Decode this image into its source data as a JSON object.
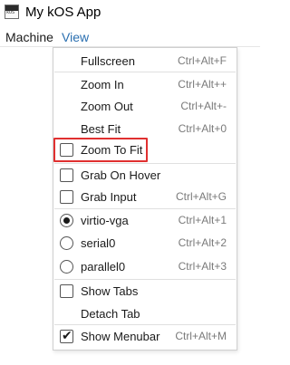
{
  "window": {
    "title": "My kOS App",
    "icon": "kos-app-icon",
    "icon_text": "kOS"
  },
  "menubar": {
    "items": [
      {
        "label": "Machine"
      },
      {
        "label": "View"
      }
    ]
  },
  "view_menu": {
    "items": [
      {
        "label": "Fullscreen",
        "shortcut": "Ctrl+Alt+F"
      },
      {
        "label": "Zoom In",
        "shortcut": "Ctrl+Alt++"
      },
      {
        "label": "Zoom Out",
        "shortcut": "Ctrl+Alt+-"
      },
      {
        "label": "Best Fit",
        "shortcut": "Ctrl+Alt+0"
      },
      {
        "label": "Zoom To Fit",
        "shortcut": "",
        "checked": false
      },
      {
        "label": "Grab On Hover",
        "shortcut": "",
        "checked": false
      },
      {
        "label": "Grab Input",
        "shortcut": "Ctrl+Alt+G",
        "checked": false
      },
      {
        "label": "virtio-vga",
        "shortcut": "Ctrl+Alt+1",
        "selected": true
      },
      {
        "label": "serial0",
        "shortcut": "Ctrl+Alt+2",
        "selected": false
      },
      {
        "label": "parallel0",
        "shortcut": "Ctrl+Alt+3",
        "selected": false
      },
      {
        "label": "Show Tabs",
        "shortcut": "",
        "checked": false
      },
      {
        "label": "Detach Tab",
        "shortcut": ""
      },
      {
        "label": "Show Menubar",
        "shortcut": "Ctrl+Alt+M",
        "checked": true
      }
    ]
  },
  "colors": {
    "active_menu_text": "#2a6fb0",
    "highlight_border": "#e03030"
  }
}
